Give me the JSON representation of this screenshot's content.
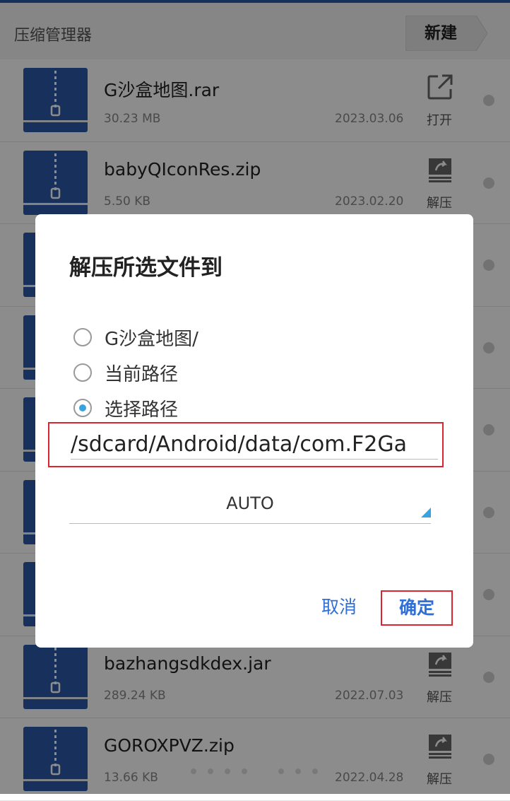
{
  "header": {
    "title": "压缩管理器",
    "new_button": "新建"
  },
  "files": [
    {
      "name": "G沙盒地图.rar",
      "size": "30.23 MB",
      "date": "2023.03.06",
      "action": "打开",
      "action_icon": "open-external-icon"
    },
    {
      "name": "babyQIconRes.zip",
      "size": "5.50 KB",
      "date": "2023.02.20",
      "action": "解压",
      "action_icon": "extract-icon"
    },
    {
      "name": "",
      "size": "",
      "date": "",
      "action": "",
      "action_icon": "extract-icon"
    },
    {
      "name": "",
      "size": "",
      "date": "",
      "action": "",
      "action_icon": "extract-icon"
    },
    {
      "name": "",
      "size": "",
      "date": "",
      "action": "",
      "action_icon": "extract-icon"
    },
    {
      "name": "",
      "size": "",
      "date": "",
      "action": "",
      "action_icon": "extract-icon"
    },
    {
      "name": "",
      "size": "",
      "date": "",
      "action": "",
      "action_icon": "extract-icon"
    },
    {
      "name": "bazhangsdkdex.jar",
      "size": "289.24 KB",
      "date": "2022.07.03",
      "action": "解压",
      "action_icon": "extract-icon"
    },
    {
      "name": "GOROXPVZ.zip",
      "size": "13.66 KB",
      "date": "2022.04.28",
      "action": "解压",
      "action_icon": "extract-icon"
    }
  ],
  "dialog": {
    "title": "解压所选文件到",
    "options": [
      {
        "label": "G沙盒地图/",
        "checked": false
      },
      {
        "label": "当前路径",
        "checked": false
      },
      {
        "label": "选择路径",
        "checked": true
      }
    ],
    "path_value": "/sdcard/Android/data/com.F2Ga",
    "encoding_value": "AUTO",
    "cancel": "取消",
    "confirm": "确定"
  },
  "pager": {
    "total": 8,
    "active_index": 4
  },
  "colors": {
    "accent": "#39a3e0",
    "link": "#2f6fd6",
    "highlight": "#d9262e",
    "file_icon": "#2c5aa8"
  }
}
